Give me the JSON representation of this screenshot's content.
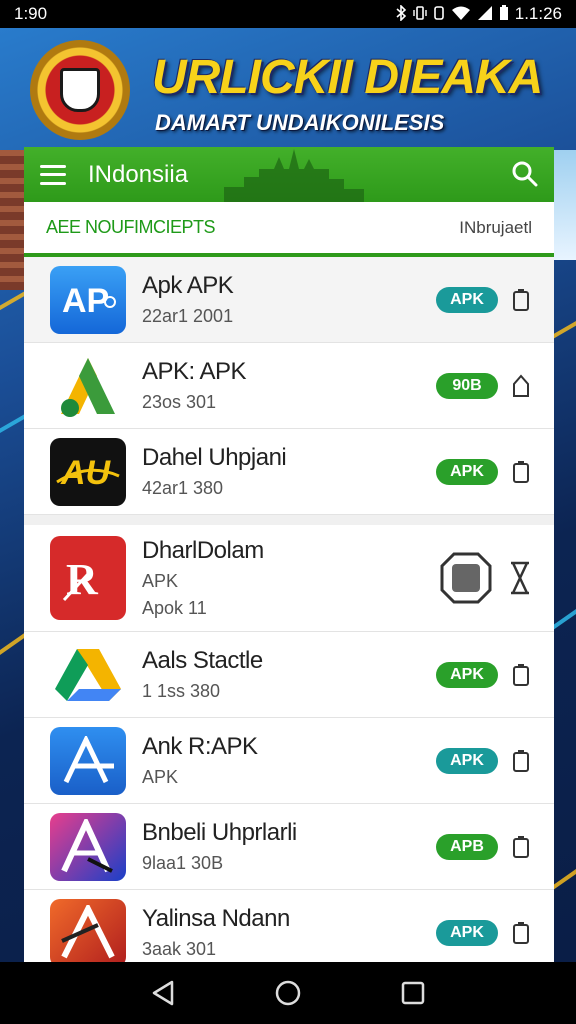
{
  "status_bar": {
    "time_left": "1:90",
    "time_right": "1.1:26"
  },
  "banner": {
    "title": "URLICKII DIEAKA",
    "subtitle": "DAMART UNDAIKONILESIS"
  },
  "app_bar": {
    "title": "INdonsiia"
  },
  "tabs": {
    "active": "AEE NOUFIMCIEPTS",
    "other": "INbrujaetl"
  },
  "apps": [
    {
      "name": "Apk APK",
      "meta": "22ar1 2001",
      "badge": "APK",
      "badge_color": "#1a9a9a"
    },
    {
      "name": "APK: APK",
      "meta": "23os 301",
      "badge": "90B",
      "badge_color": "#2aa02a"
    },
    {
      "name": "Dahel Uhpjani",
      "meta": "42ar1 380",
      "badge": "APK",
      "badge_color": "#2aa02a"
    },
    {
      "name": "DharlDolam",
      "meta": "APK",
      "meta2": "Apok    11",
      "badge": ""
    },
    {
      "name": "Aals Stactle",
      "meta": "1 1ss 380",
      "badge": "APK",
      "badge_color": "#2aa02a"
    },
    {
      "name": "Ank R:APK",
      "meta": "APK",
      "badge": "APK",
      "badge_color": "#1a9a9a"
    },
    {
      "name": "Bnbeli Uhprlarli",
      "meta": "9laa1 30B",
      "badge": "APB",
      "badge_color": "#2aa02a"
    },
    {
      "name": "Yalinsa Ndann",
      "meta": "3aak 301",
      "badge": "APK",
      "badge_color": "#1a9a9a"
    }
  ],
  "icons": {
    "menu": "hamburger-menu-icon",
    "search": "search-icon",
    "download": "download-icon",
    "back": "back-triangle-icon",
    "home": "home-circle-icon",
    "recents": "recents-square-icon"
  }
}
